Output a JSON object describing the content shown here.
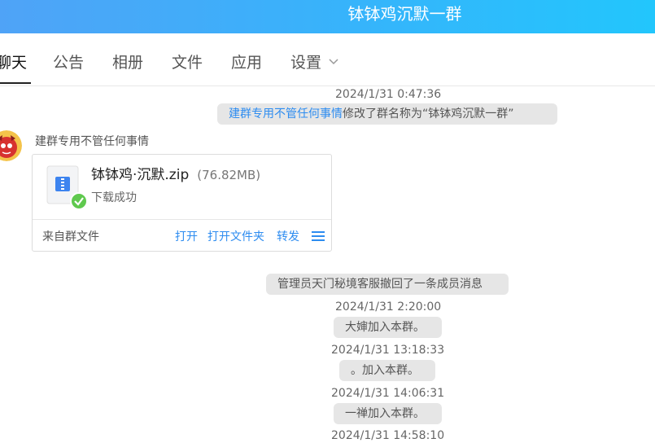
{
  "window": {
    "title": "钵钵鸡沉默一群"
  },
  "tabs": [
    {
      "label": "聊天",
      "active": true
    },
    {
      "label": "公告"
    },
    {
      "label": "相册"
    },
    {
      "label": "文件"
    },
    {
      "label": "应用"
    },
    {
      "label": "设置"
    }
  ],
  "messages": {
    "t1": "2024/1/31 0:47:36",
    "rename_user": "建群专用不管任何事情",
    "rename_text": "修改了群名称为“钵钵鸡沉默一群”",
    "sender": "建群专用不管任何事情",
    "file": {
      "name": "钵钵鸡·沉默.zip",
      "size": "(76.82MB)",
      "status": "下载成功",
      "source": "来自群文件",
      "action_open": "打开",
      "action_open_folder": "打开文件夹",
      "action_forward": "转发"
    },
    "recall": "管理员天门秘境客服撤回了一条成员消息",
    "t2": "2024/1/31 2:20:00",
    "join1": "大婶加入本群。",
    "t3": "2024/1/31 13:18:33",
    "join2": "。加入本群。",
    "t4": "2024/1/31 14:06:31",
    "join3": "一禅加入本群。",
    "t5": "2024/1/31 14:58:10"
  },
  "colors": {
    "titlebar_start": "#4fa3f7",
    "titlebar_end": "#22c6fc",
    "link": "#2d8cf0",
    "pill_bg": "#e6e6e6",
    "success": "#5fc94e"
  },
  "icons": {
    "settings_dropdown": "chevron-down-icon",
    "file": "zip-file-icon",
    "status": "check-circle-icon",
    "menu": "menu-lines-icon"
  }
}
